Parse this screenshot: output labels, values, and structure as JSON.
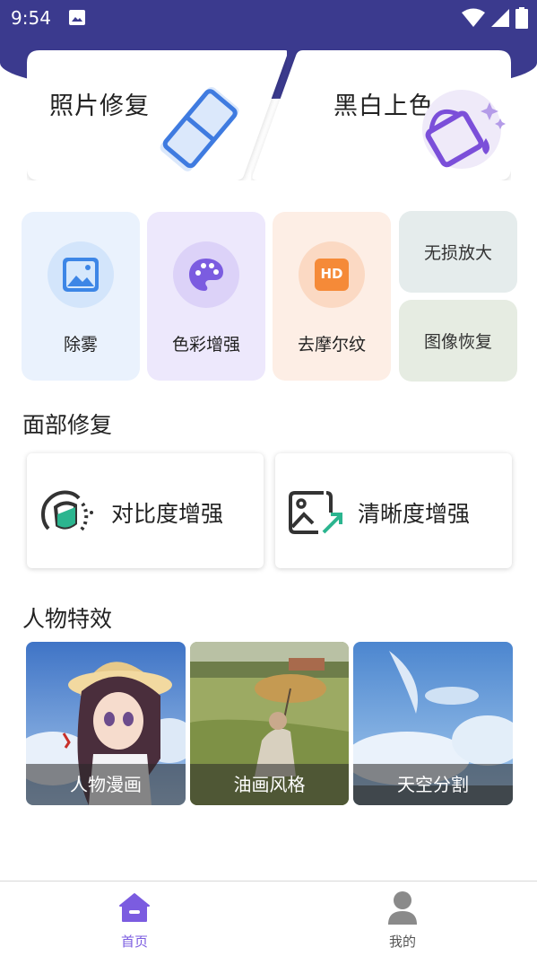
{
  "status_bar": {
    "time": "9:54"
  },
  "hero": {
    "left_title": "照片修复",
    "right_title": "黑白上色"
  },
  "tools": {
    "defog": "除雾",
    "color_enhance": "色彩增强",
    "demoire": "去摩尔纹",
    "hd_badge": "HD",
    "lossless_upscale": "无损放大",
    "image_restore": "图像恢复"
  },
  "face_section": {
    "title": "面部修复",
    "contrast": "对比度增强",
    "clarity": "清晰度增强"
  },
  "effects_section": {
    "title": "人物特效",
    "items": [
      "人物漫画",
      "油画风格",
      "天空分割"
    ]
  },
  "bottom_nav": {
    "home": "首页",
    "mine": "我的"
  },
  "colors": {
    "brand": "#3b3a8e",
    "accent_purple": "#7b5ce0",
    "nav_active": "#7b5ce0",
    "nav_inactive": "#555555"
  }
}
